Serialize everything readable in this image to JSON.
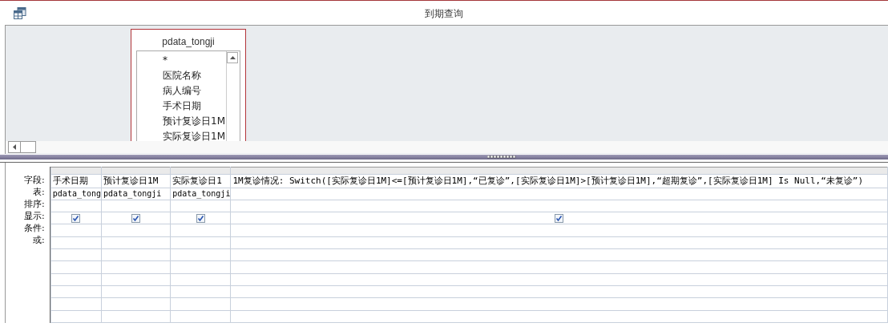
{
  "window": {
    "title": "到期查询"
  },
  "field_list": {
    "table": "pdata_tongji",
    "fields": [
      "*",
      "医院名称",
      "病人编号",
      "手术日期",
      "预计复诊日1M",
      "实际复诊日1M"
    ]
  },
  "grid": {
    "row_labels": [
      "字段:",
      "表:",
      "排序:",
      "显示:",
      "条件:",
      "或:"
    ],
    "columns": [
      {
        "field": "手术日期",
        "table": "pdata_tong",
        "show": true
      },
      {
        "field": "预计复诊日1M",
        "table": "pdata_tongji",
        "show": true
      },
      {
        "field": "实际复诊日1",
        "table": "pdata_tongji",
        "show": true
      },
      {
        "field": "1M复诊情况: Switch([实际复诊日1M]<=[预计复诊日1M],“已复诊”,[实际复诊日1M]>[预计复诊日1M],“超期复诊”,[实际复诊日1M] Is Null,“未复诊”)",
        "show": true
      }
    ]
  }
}
